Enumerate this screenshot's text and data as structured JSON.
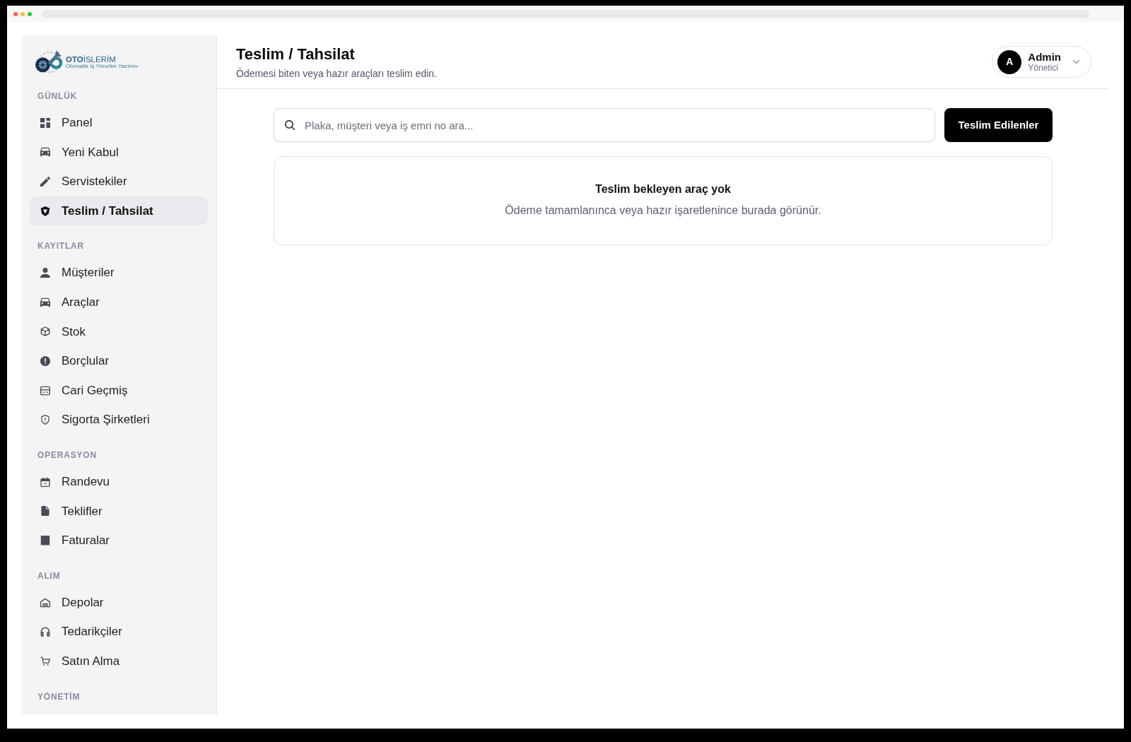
{
  "sidebar": {
    "logo": {
      "name": "**OTO**İSLERİM",
      "tagline": "Otomatik İş Yönetim Yazılımı"
    },
    "sections": [
      {
        "label": "GÜNLÜK",
        "items": [
          {
            "label": "Panel",
            "selected": false
          },
          {
            "label": "Yeni Kabul",
            "selected": false
          },
          {
            "label": "Servistekiler",
            "selected": false
          },
          {
            "label": "Teslim / Tahsilat",
            "selected": true
          }
        ]
      },
      {
        "label": "KAYITLAR",
        "items": [
          {
            "label": "Müşteriler",
            "selected": false
          },
          {
            "label": "Araçlar",
            "selected": false
          },
          {
            "label": "Stok",
            "selected": false
          },
          {
            "label": "Borçlular",
            "selected": false
          },
          {
            "label": "Cari Geçmiş",
            "selected": false
          },
          {
            "label": "Sigorta Şirketleri",
            "selected": false
          }
        ]
      },
      {
        "label": "OPERASYON",
        "items": [
          {
            "label": "Randevu",
            "selected": false
          },
          {
            "label": "Teklifler",
            "selected": false
          },
          {
            "label": "Faturalar",
            "selected": false
          }
        ]
      },
      {
        "label": "ALIM",
        "items": [
          {
            "label": "Depolar",
            "selected": false
          },
          {
            "label": "Tedarikçiler",
            "selected": false
          },
          {
            "label": "Satın Alma",
            "selected": false
          }
        ]
      },
      {
        "label": "YÖNETİM"
      }
    ]
  },
  "header": {
    "title": "Teslim / Tahsilat",
    "subtitle": "Ödemesi biten veya hazır araçları teslim edin."
  },
  "user": {
    "initial": "A",
    "name": "Admin",
    "role": "Yönetici"
  },
  "search": {
    "placeholder": "Plaka, müşteri veya iş emri no ara..."
  },
  "toolbar_button": "Teslim Edilenler",
  "empty_state": {
    "title": "Teslim bekleyen araç yok",
    "message": "Ödeme tamamlanınca veya hazır işaretlenince burada görünür."
  }
}
